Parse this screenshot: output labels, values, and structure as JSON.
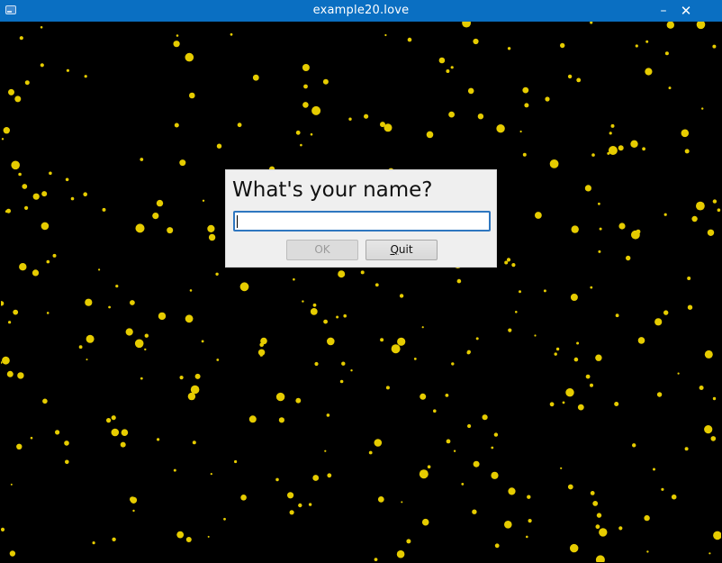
{
  "window": {
    "title": "example20.love",
    "minimize_glyph": "–",
    "close_glyph": "✕",
    "icon": "window-icon"
  },
  "scene": {
    "background_color": "#000000",
    "particle_color": "#e6cc00",
    "description_icon": "star-particles"
  },
  "dialog": {
    "prompt": "What's your name?",
    "input": {
      "value": "",
      "placeholder": ""
    },
    "ok_label": "OK",
    "ok_enabled": false,
    "quit_label_mnemonic": "Q",
    "quit_label_rest": "uit"
  },
  "colors": {
    "titlebar": "#0a6fc2",
    "dialog_bg": "#efefef",
    "input_focus": "#2f77c0"
  }
}
